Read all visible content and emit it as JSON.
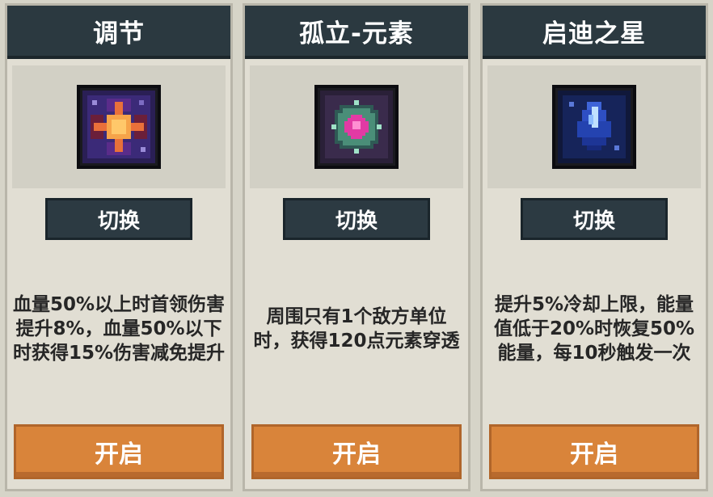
{
  "cards": [
    {
      "title": "调节",
      "icon": "orange-star-icon",
      "switch_label": "切换",
      "description": "血量50%以上时首领伤害提升8%，血量50%以下时获得15%伤害减免提升",
      "open_label": "开启"
    },
    {
      "title": "孤立-元素",
      "icon": "pink-gem-icon",
      "switch_label": "切换",
      "description": "周围只有1个敌方单位时，获得120点元素穿透",
      "open_label": "开启"
    },
    {
      "title": "启迪之星",
      "icon": "blue-crystal-icon",
      "switch_label": "切换",
      "description": "提升5%冷却上限，能量值低于20%时恢复50%能量，每10秒触发一次",
      "open_label": "开启"
    }
  ]
}
